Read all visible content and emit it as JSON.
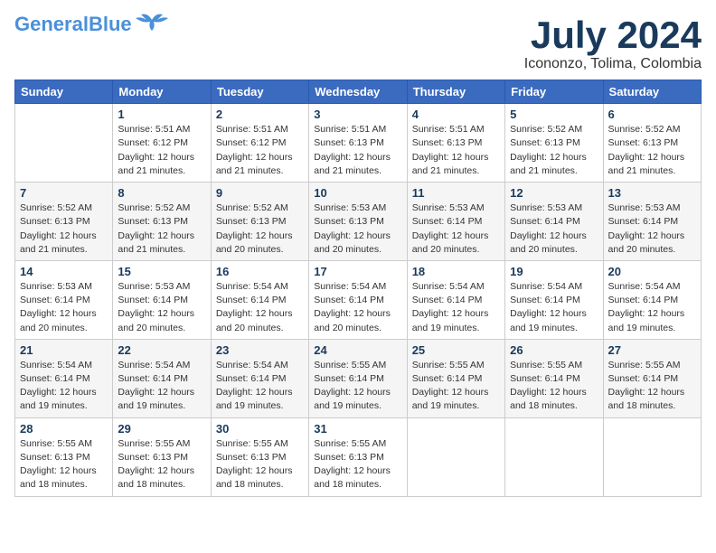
{
  "header": {
    "logo_line1": "General",
    "logo_line2": "Blue",
    "month_year": "July 2024",
    "location": "Icononzo, Tolima, Colombia"
  },
  "weekdays": [
    "Sunday",
    "Monday",
    "Tuesday",
    "Wednesday",
    "Thursday",
    "Friday",
    "Saturday"
  ],
  "weeks": [
    [
      {
        "day": "",
        "info": ""
      },
      {
        "day": "1",
        "info": "Sunrise: 5:51 AM\nSunset: 6:12 PM\nDaylight: 12 hours\nand 21 minutes."
      },
      {
        "day": "2",
        "info": "Sunrise: 5:51 AM\nSunset: 6:12 PM\nDaylight: 12 hours\nand 21 minutes."
      },
      {
        "day": "3",
        "info": "Sunrise: 5:51 AM\nSunset: 6:13 PM\nDaylight: 12 hours\nand 21 minutes."
      },
      {
        "day": "4",
        "info": "Sunrise: 5:51 AM\nSunset: 6:13 PM\nDaylight: 12 hours\nand 21 minutes."
      },
      {
        "day": "5",
        "info": "Sunrise: 5:52 AM\nSunset: 6:13 PM\nDaylight: 12 hours\nand 21 minutes."
      },
      {
        "day": "6",
        "info": "Sunrise: 5:52 AM\nSunset: 6:13 PM\nDaylight: 12 hours\nand 21 minutes."
      }
    ],
    [
      {
        "day": "7",
        "info": "Sunrise: 5:52 AM\nSunset: 6:13 PM\nDaylight: 12 hours\nand 21 minutes."
      },
      {
        "day": "8",
        "info": "Sunrise: 5:52 AM\nSunset: 6:13 PM\nDaylight: 12 hours\nand 21 minutes."
      },
      {
        "day": "9",
        "info": "Sunrise: 5:52 AM\nSunset: 6:13 PM\nDaylight: 12 hours\nand 20 minutes."
      },
      {
        "day": "10",
        "info": "Sunrise: 5:53 AM\nSunset: 6:13 PM\nDaylight: 12 hours\nand 20 minutes."
      },
      {
        "day": "11",
        "info": "Sunrise: 5:53 AM\nSunset: 6:14 PM\nDaylight: 12 hours\nand 20 minutes."
      },
      {
        "day": "12",
        "info": "Sunrise: 5:53 AM\nSunset: 6:14 PM\nDaylight: 12 hours\nand 20 minutes."
      },
      {
        "day": "13",
        "info": "Sunrise: 5:53 AM\nSunset: 6:14 PM\nDaylight: 12 hours\nand 20 minutes."
      }
    ],
    [
      {
        "day": "14",
        "info": "Sunrise: 5:53 AM\nSunset: 6:14 PM\nDaylight: 12 hours\nand 20 minutes."
      },
      {
        "day": "15",
        "info": "Sunrise: 5:53 AM\nSunset: 6:14 PM\nDaylight: 12 hours\nand 20 minutes."
      },
      {
        "day": "16",
        "info": "Sunrise: 5:54 AM\nSunset: 6:14 PM\nDaylight: 12 hours\nand 20 minutes."
      },
      {
        "day": "17",
        "info": "Sunrise: 5:54 AM\nSunset: 6:14 PM\nDaylight: 12 hours\nand 20 minutes."
      },
      {
        "day": "18",
        "info": "Sunrise: 5:54 AM\nSunset: 6:14 PM\nDaylight: 12 hours\nand 19 minutes."
      },
      {
        "day": "19",
        "info": "Sunrise: 5:54 AM\nSunset: 6:14 PM\nDaylight: 12 hours\nand 19 minutes."
      },
      {
        "day": "20",
        "info": "Sunrise: 5:54 AM\nSunset: 6:14 PM\nDaylight: 12 hours\nand 19 minutes."
      }
    ],
    [
      {
        "day": "21",
        "info": "Sunrise: 5:54 AM\nSunset: 6:14 PM\nDaylight: 12 hours\nand 19 minutes."
      },
      {
        "day": "22",
        "info": "Sunrise: 5:54 AM\nSunset: 6:14 PM\nDaylight: 12 hours\nand 19 minutes."
      },
      {
        "day": "23",
        "info": "Sunrise: 5:54 AM\nSunset: 6:14 PM\nDaylight: 12 hours\nand 19 minutes."
      },
      {
        "day": "24",
        "info": "Sunrise: 5:55 AM\nSunset: 6:14 PM\nDaylight: 12 hours\nand 19 minutes."
      },
      {
        "day": "25",
        "info": "Sunrise: 5:55 AM\nSunset: 6:14 PM\nDaylight: 12 hours\nand 19 minutes."
      },
      {
        "day": "26",
        "info": "Sunrise: 5:55 AM\nSunset: 6:14 PM\nDaylight: 12 hours\nand 18 minutes."
      },
      {
        "day": "27",
        "info": "Sunrise: 5:55 AM\nSunset: 6:14 PM\nDaylight: 12 hours\nand 18 minutes."
      }
    ],
    [
      {
        "day": "28",
        "info": "Sunrise: 5:55 AM\nSunset: 6:13 PM\nDaylight: 12 hours\nand 18 minutes."
      },
      {
        "day": "29",
        "info": "Sunrise: 5:55 AM\nSunset: 6:13 PM\nDaylight: 12 hours\nand 18 minutes."
      },
      {
        "day": "30",
        "info": "Sunrise: 5:55 AM\nSunset: 6:13 PM\nDaylight: 12 hours\nand 18 minutes."
      },
      {
        "day": "31",
        "info": "Sunrise: 5:55 AM\nSunset: 6:13 PM\nDaylight: 12 hours\nand 18 minutes."
      },
      {
        "day": "",
        "info": ""
      },
      {
        "day": "",
        "info": ""
      },
      {
        "day": "",
        "info": ""
      }
    ]
  ]
}
